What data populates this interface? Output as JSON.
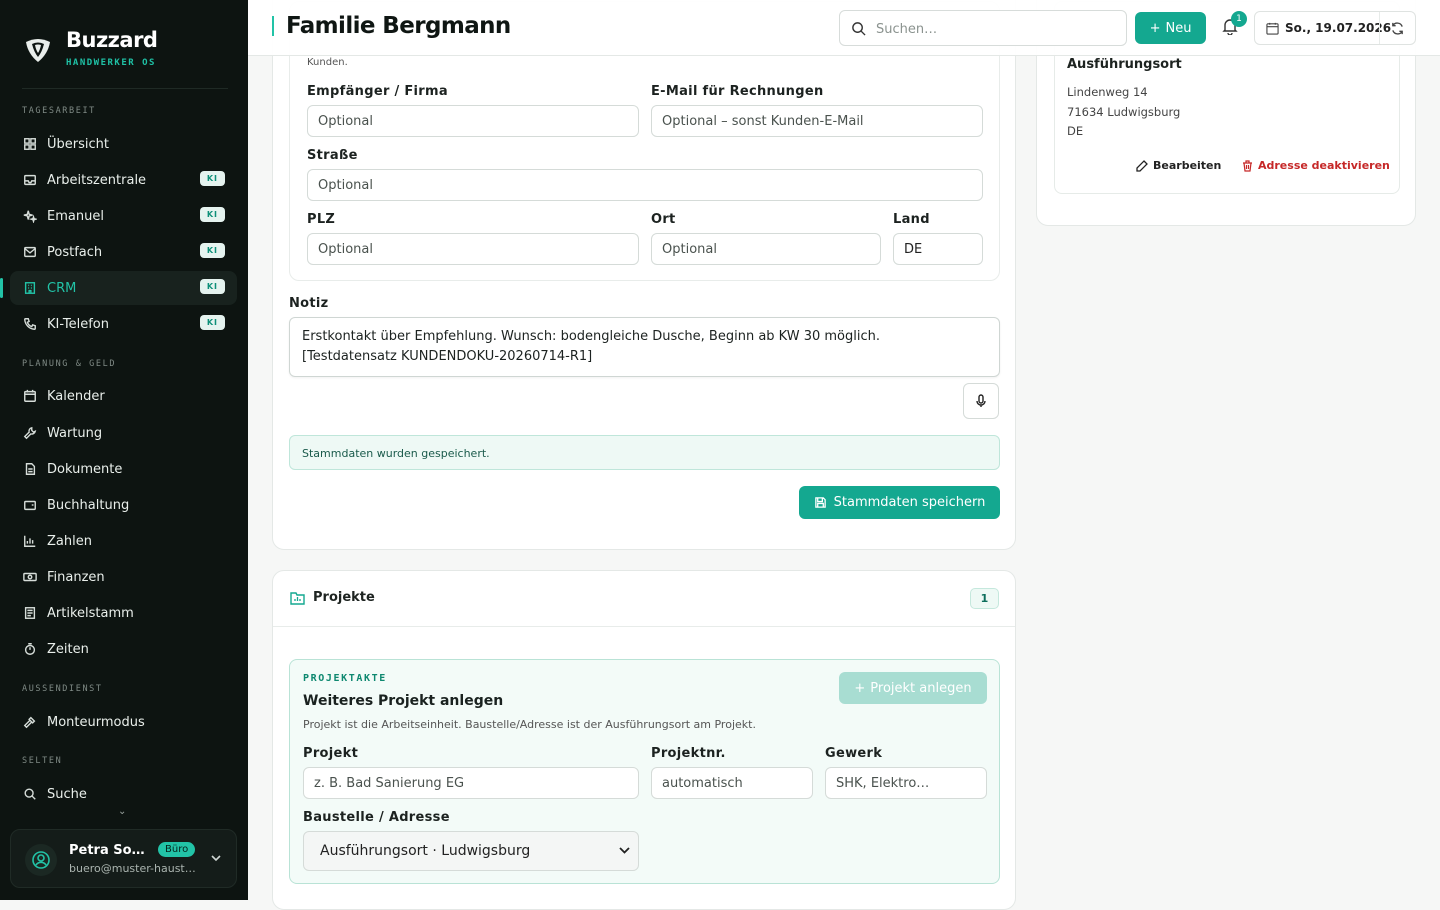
{
  "app": {
    "name": "Buzzard",
    "subtitle": "HANDWERKER OS"
  },
  "sidebar": {
    "sections": [
      "TAGESARBEIT",
      "PLANUNG & GELD",
      "AUSSENDIENST",
      "SELTEN"
    ],
    "items": [
      {
        "label": "Übersicht",
        "icon": "grid-icon"
      },
      {
        "label": "Arbeitszentrale",
        "icon": "inbox-icon",
        "badge": "KI"
      },
      {
        "label": "Emanuel",
        "icon": "sparkles-icon",
        "badge": "KI"
      },
      {
        "label": "Postfach",
        "icon": "mail-icon",
        "badge": "KI"
      },
      {
        "label": "CRM",
        "icon": "building-icon",
        "badge": "KI",
        "active": true
      },
      {
        "label": "KI-Telefon",
        "icon": "phone-icon",
        "badge": "KI"
      },
      {
        "label": "Kalender",
        "icon": "calendar-icon"
      },
      {
        "label": "Wartung",
        "icon": "wrench-icon"
      },
      {
        "label": "Dokumente",
        "icon": "document-icon"
      },
      {
        "label": "Buchhaltung",
        "icon": "wallet-icon"
      },
      {
        "label": "Zahlen",
        "icon": "chart-icon"
      },
      {
        "label": "Finanzen",
        "icon": "banknote-icon"
      },
      {
        "label": "Artikelstamm",
        "icon": "list-icon"
      },
      {
        "label": "Zeiten",
        "icon": "timer-icon"
      },
      {
        "label": "Monteurmodus",
        "icon": "hammer-icon"
      },
      {
        "label": "Suche",
        "icon": "search-icon"
      }
    ]
  },
  "user": {
    "name": "Petra So…",
    "role": "Büro",
    "email": "buero@muster-haust…"
  },
  "topbar": {
    "title": "Familie Bergmann",
    "search_placeholder": "Suchen…",
    "new_label": "Neu",
    "notif_count": "1",
    "date": "So., 19.07.2026"
  },
  "billing": {
    "kunden_text": "Kunden.",
    "faded_text": "Nur für Rechnungen und Mahnungen - z. B. Hausverwaltung, Versicherung oder Gewerbekunden abweichend vom Kunden.",
    "recipient_label": "Empfänger / Firma",
    "recipient_placeholder": "Optional",
    "email_label": "E-Mail für Rechnungen",
    "email_placeholder": "Optional – sonst Kunden-E-Mail",
    "street_label": "Straße",
    "street_placeholder": "Optional",
    "zip_label": "PLZ",
    "zip_placeholder": "Optional",
    "city_label": "Ort",
    "city_placeholder": "Optional",
    "country_label": "Land",
    "country_value": "DE"
  },
  "note": {
    "label": "Notiz",
    "line1": "Erstkontakt über Empfehlung. Wunsch: bodengleiche Dusche, Beginn ab KW 30 möglich.",
    "line2": "[Testdatensatz KUNDENDOKU-20260714-R1]"
  },
  "status": {
    "saved": "Stammdaten wurden gespeichert."
  },
  "save_label": "Stammdaten speichern",
  "address": {
    "title": "Ausführungsort",
    "street": "Lindenweg 14",
    "city": "71634 Ludwigsburg",
    "country": "DE",
    "edit_label": "Bearbeiten",
    "deactivate_label": "Adresse deaktivieren"
  },
  "projects": {
    "title": "Projekte",
    "count": "1",
    "kicker": "PROJEKTAKTE",
    "heading": "Weiteres Projekt anlegen",
    "description": "Projekt ist die Arbeitseinheit. Baustelle/Adresse ist der Ausführungsort am Projekt.",
    "create_label": "Projekt anlegen",
    "project_label": "Projekt",
    "project_placeholder": "z. B. Bad Sanierung EG",
    "number_label": "Projektnr.",
    "number_placeholder": "automatisch",
    "trade_label": "Gewerk",
    "trade_placeholder": "SHK, Elektro…",
    "site_label": "Baustelle / Adresse",
    "site_value": "Ausführungsort · Ludwigsburg"
  },
  "colors": {
    "accent": "#14a890",
    "sidebar_bg": "#0d1411",
    "danger": "#c62828"
  }
}
